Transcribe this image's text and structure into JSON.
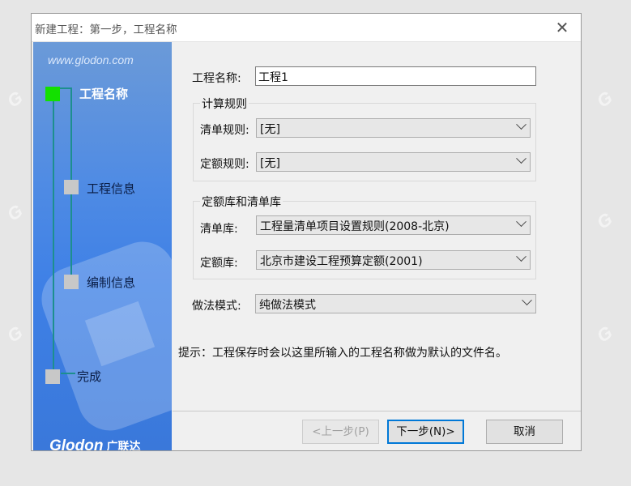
{
  "dialog": {
    "title": "新建工程：第一步，工程名称",
    "close_glyph": "✕"
  },
  "sidebar": {
    "url": "www.glodon.com",
    "steps": [
      {
        "label": "工程名称",
        "active": true
      },
      {
        "label": "工程信息",
        "active": false
      },
      {
        "label": "编制信息",
        "active": false
      },
      {
        "label": "完成",
        "active": false
      }
    ],
    "brand": "Glodon",
    "brand_cn": "广联达"
  },
  "form": {
    "project_name_label": "工程名称:",
    "project_name_value": "工程1",
    "calc_rules_caption": "计算规则",
    "bill_rule_label": "清单规则:",
    "bill_rule_value": "[无]",
    "quota_rule_label": "定额规则:",
    "quota_rule_value": "[无]",
    "libraries_caption": "定额库和清单库",
    "bill_lib_label": "清单库:",
    "bill_lib_value": "工程量清单项目设置规则(2008-北京)",
    "quota_lib_label": "定额库:",
    "quota_lib_value": "北京市建设工程预算定额(2001)",
    "method_label": "做法模式:",
    "method_value": "纯做法模式",
    "hint": "提示：工程保存时会以这里所输入的工程名称做为默认的文件名。"
  },
  "buttons": {
    "prev": "<上一步(P)",
    "next": "下一步(N)>",
    "cancel": "取消"
  },
  "colors": {
    "accent": "#0078d7",
    "sidebar": "#4f8be4",
    "active_step": "#13e000"
  }
}
